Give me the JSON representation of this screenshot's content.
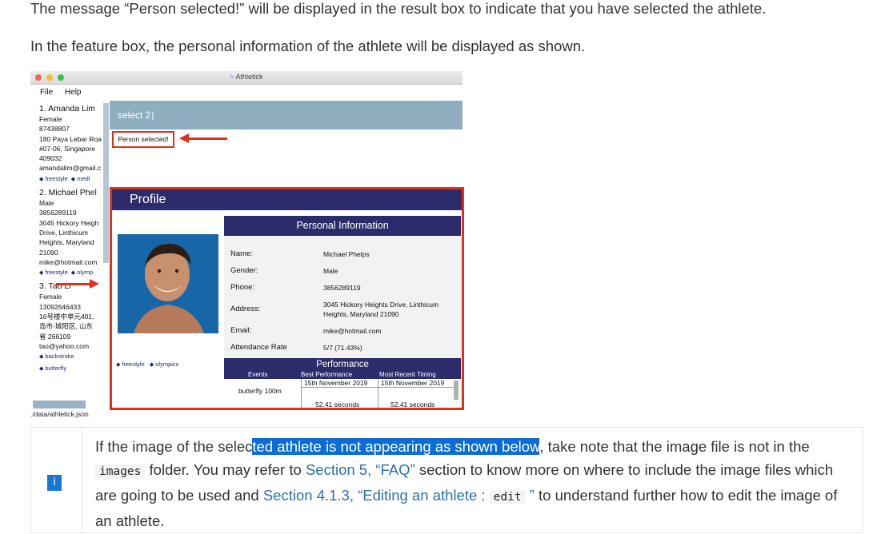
{
  "doc": {
    "para1": "The message “Person selected!” will be displayed in the result box to indicate that you have selected the athlete.",
    "para2": "In the feature box, the personal information of the athlete will be displayed as shown."
  },
  "app": {
    "window_title": "Athletick",
    "menu": [
      "File",
      "Help"
    ],
    "command_text": "select 2",
    "result_text": "Person selected!",
    "status_path": "./data/athletick.json",
    "persons": [
      {
        "name": "1.  Amanda Lim",
        "lines": [
          "Female",
          "87438807",
          "180 Paya Lebar Roa",
          "#07-06, Singapore",
          "409032",
          "amandalim@gmail.c"
        ],
        "tags": [
          "freestyle",
          "medl"
        ]
      },
      {
        "name": "2.  Michael Phel",
        "lines": [
          "Male",
          "3856289119",
          "3045 Hickory Heigh",
          "Drive, Linthicum",
          "Heights, Maryland",
          "21090",
          "mike@hotmail.com"
        ],
        "tags": [
          "freestyle",
          "olymp"
        ]
      },
      {
        "name": "3.  Tao Li",
        "lines": [
          "Female",
          "13092646433",
          "16号楼中单元401,",
          "岛市-城阳区, 山东",
          "省 266109",
          "tao@yahoo.com"
        ],
        "tags": [
          "backstroke",
          "butterfly"
        ]
      }
    ],
    "profile": {
      "header": "Profile",
      "tags": [
        "freestyle",
        "olympics"
      ],
      "info_header": "Personal Information",
      "fields": [
        {
          "label": "Name:",
          "value": "Michael Phelps"
        },
        {
          "label": "Gender:",
          "value": "Male"
        },
        {
          "label": "Phone:",
          "value": "3856289119"
        },
        {
          "label": "Address:",
          "value": "3045 Hickory Heights Drive, Linthicum Heights, Maryland 21090"
        },
        {
          "label": "Email:",
          "value": "mike@hotmail.com"
        },
        {
          "label": "Attendance Rate",
          "value": "5/7 (71.43%)"
        }
      ],
      "performance": {
        "header": "Performance",
        "columns": [
          "Events",
          "Best Performance",
          "Most Recent Timing"
        ],
        "event": "butterfly 100m",
        "best_date": "15th November 2019",
        "recent_date": "15th November 2019",
        "best_time": "52.41 seconds",
        "recent_time": "52.41 seconds"
      }
    }
  },
  "admonition": {
    "icon": "info-icon",
    "icon_glyph": "i",
    "t1": "If the image of the selec",
    "t1_selected": "ted athlete is not appearing as shown below",
    "t2": ", take note that the image file is not in the",
    "code1": "images",
    "t3": " folder. You may refer to ",
    "link1": "Section 5, “FAQ”",
    "t4": " section to know more on where to include the image files which are going to be used and ",
    "link2": "Section 4.1.3, “Editing an athlete : ",
    "code2": "edit",
    "link2_end": " ”",
    "t5": " to understand further how to edit the image of an athlete."
  },
  "colors": {
    "accent_red": "#e0301e",
    "navy": "#2d2c6b",
    "command_bg": "#8eaec0",
    "link": "#2f6fb0",
    "selection": "#0a6cd4"
  }
}
